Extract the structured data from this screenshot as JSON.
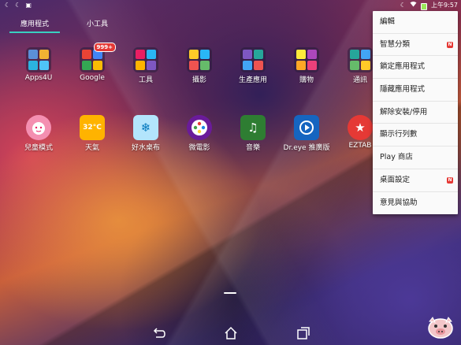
{
  "status_bar": {
    "left_icons": [
      "moon-icon",
      "moon-icon",
      "gallery-icon"
    ],
    "time": "上午9:57"
  },
  "tabs": [
    {
      "label": "應用程式",
      "active": true
    },
    {
      "label": "小工具",
      "active": false
    }
  ],
  "apps_row1": [
    {
      "label": "Apps4U",
      "icon": "folder-icon",
      "badge": ""
    },
    {
      "label": "Google",
      "icon": "folder-icon",
      "badge": "999+"
    },
    {
      "label": "工具",
      "icon": "folder-icon",
      "badge": ""
    },
    {
      "label": "攝影",
      "icon": "folder-icon",
      "badge": ""
    },
    {
      "label": "生產應用",
      "icon": "folder-icon",
      "badge": ""
    },
    {
      "label": "購物",
      "icon": "folder-icon",
      "badge": ""
    },
    {
      "label": "通訊",
      "icon": "folder-icon",
      "badge": ""
    }
  ],
  "apps_row2": [
    {
      "label": "兒童模式",
      "icon": "kids-mode-icon"
    },
    {
      "label": "天氣",
      "icon": "weather-icon",
      "icon_text": "32°C"
    },
    {
      "label": "好水桌布",
      "icon": "wallpaper-icon"
    },
    {
      "label": "微電影",
      "icon": "minimovie-icon"
    },
    {
      "label": "音樂",
      "icon": "music-icon"
    },
    {
      "label": "Dr.eye 推廣版",
      "icon": "dreye-icon"
    },
    {
      "label": "EZTAB",
      "icon": "eztable-icon"
    }
  ],
  "menu": {
    "items": [
      {
        "label": "編輯",
        "new": false
      },
      {
        "label": "智慧分類",
        "new": true
      },
      {
        "label": "鎖定應用程式",
        "new": false
      },
      {
        "label": "隱藏應用程式",
        "new": false
      },
      {
        "label": "解除安裝/停用",
        "new": false
      },
      {
        "label": "顯示行列數",
        "new": false
      },
      {
        "label": "Play 商店",
        "new": false
      },
      {
        "label": "桌面設定",
        "new": true
      },
      {
        "label": "意見與協助",
        "new": false
      }
    ],
    "new_badge_text": "N"
  },
  "nav": {
    "buttons": [
      "back-icon",
      "home-icon",
      "recents-icon"
    ]
  },
  "colors": {
    "tab_indicator": "#39d0c0",
    "badge_red": "#e53935"
  }
}
